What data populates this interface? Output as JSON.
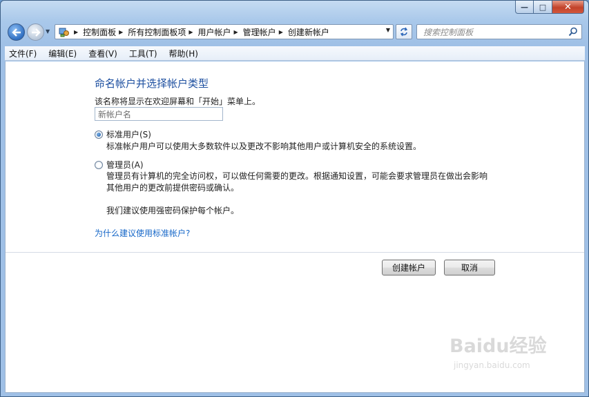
{
  "window": {
    "caption_minimize": "—",
    "caption_maximize": "□",
    "caption_close": "✕"
  },
  "nav": {
    "back_icon": "back-arrow-icon",
    "forward_icon": "forward-arrow-icon"
  },
  "address": {
    "crumbs": [
      "控制面板",
      "所有控制面板项",
      "用户帐户",
      "管理帐户",
      "创建新帐户"
    ]
  },
  "search": {
    "placeholder": "搜索控制面板"
  },
  "menu": {
    "items": [
      "文件(F)",
      "编辑(E)",
      "查看(V)",
      "工具(T)",
      "帮助(H)"
    ]
  },
  "main": {
    "title": "命名帐户并选择帐户类型",
    "description": "该名称将显示在欢迎屏幕和「开始」菜单上。",
    "name_input_value": "新帐户名",
    "standard_option": {
      "label": "标准用户(S)",
      "checked": true,
      "description": "标准帐户用户可以使用大多数软件以及更改不影响其他用户或计算机安全的系统设置。"
    },
    "admin_option": {
      "label": "管理员(A)",
      "checked": false,
      "description_line1": "管理员有计算机的完全访问权，可以做任何需要的更改。根据通知设置，可能会要求管理员在做出会影响",
      "description_line2": "其他用户的更改前提供密码或确认。",
      "recommendation": "我们建议使用强密码保护每个帐户。"
    },
    "help_link": "为什么建议使用标准帐户?",
    "create_button": "创建帐户",
    "cancel_button": "取消"
  },
  "watermark": {
    "logo": "Baidu经验",
    "url": "jingyan.baidu.com"
  },
  "colors": {
    "title_blue": "#1d4fa0",
    "link_blue": "#1667c8",
    "window_frame": "#a9c8ea"
  }
}
